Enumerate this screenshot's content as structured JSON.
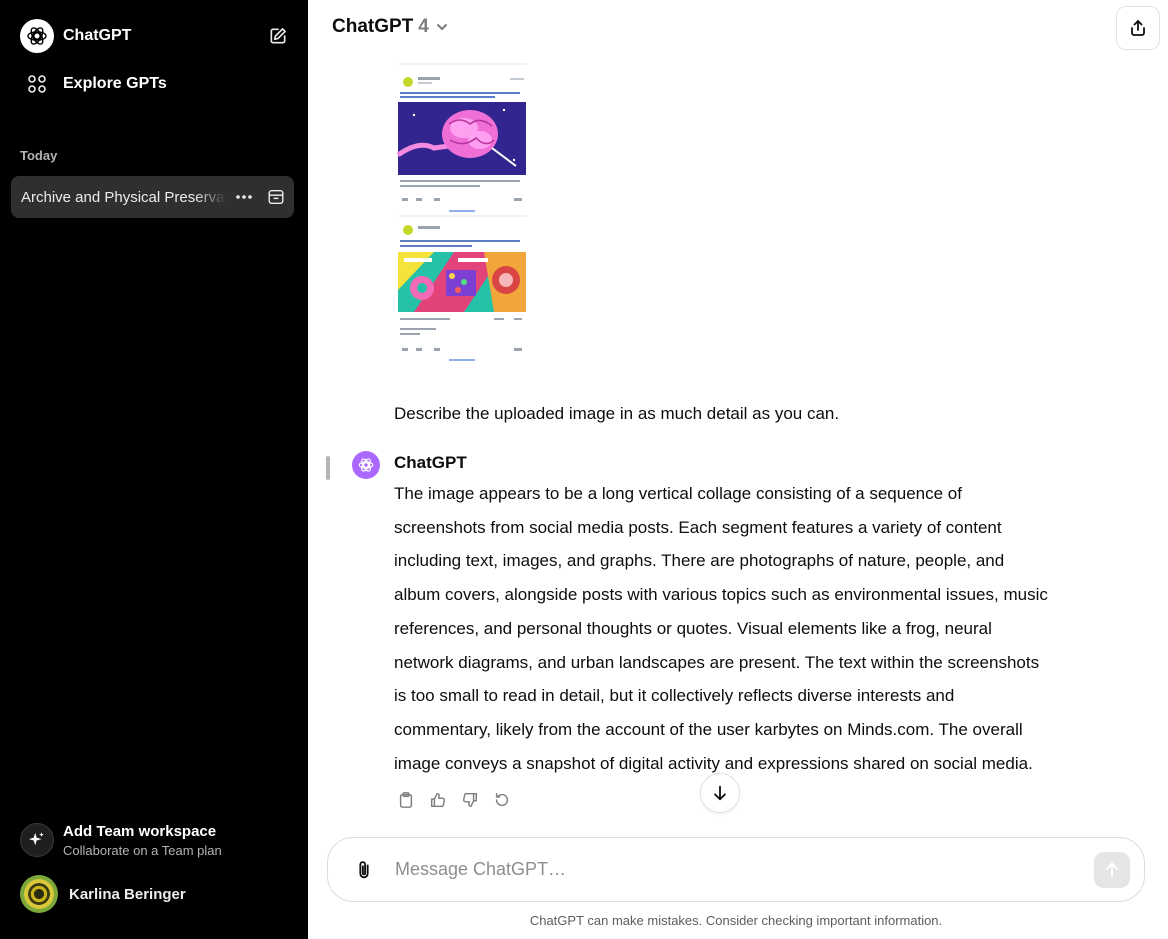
{
  "sidebar": {
    "app_title": "ChatGPT",
    "explore_label": "Explore GPTs",
    "section_today": "Today",
    "active_chat_title": "Archive and Physical Preservation",
    "team_title": "Add Team workspace",
    "team_subtitle": "Collaborate on a Team plan",
    "user_name": "Karlina Beringer"
  },
  "header": {
    "model_name": "ChatGPT",
    "model_version": "4"
  },
  "conversation": {
    "user_message": "Describe the uploaded image in as much detail as you can.",
    "assistant_name": "ChatGPT",
    "assistant_lines": [
      "The image appears to be a long vertical collage consisting of a sequence of",
      "screenshots from social media posts. Each segment features a variety of content",
      "including text, images, and graphs. There are photographs of nature, people, and",
      "album covers, alongside posts with various topics such as environmental issues, music",
      "references, and personal thoughts or quotes. Visual elements like a frog, neural",
      "network diagrams, and urban landscapes are present. The text within the screenshots",
      "is too small to read in detail, but it collectively reflects diverse interests and",
      "commentary, likely from the account of the user karbytes on Minds.com. The overall",
      "image conveys a snapshot of digital activity and expressions shared on social media."
    ]
  },
  "composer": {
    "placeholder": "Message ChatGPT…"
  },
  "footer": {
    "disclaimer": "ChatGPT can make mistakes. Consider checking important information."
  },
  "colors": {
    "sidebar_bg": "#000000",
    "active_chat_bg": "#2f2f2f",
    "assistant_avatar": "#ab68ff"
  }
}
